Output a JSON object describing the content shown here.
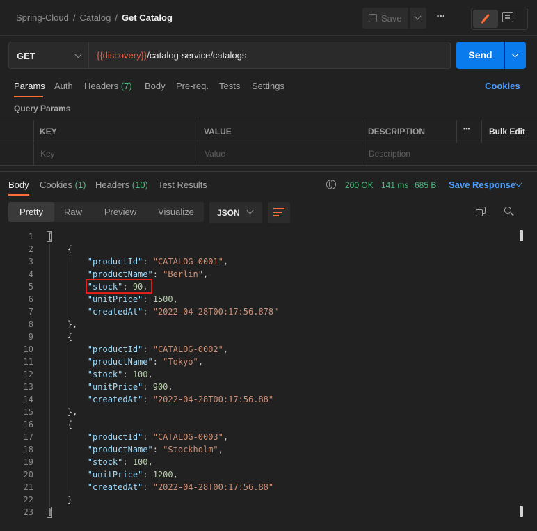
{
  "breadcrumb": {
    "items": [
      "Spring-Cloud",
      "Catalog"
    ],
    "separator": "/",
    "current": "Get Catalog"
  },
  "header": {
    "save_label": "Save",
    "more_label": "•••"
  },
  "request": {
    "method": "GET",
    "url_variable": "{{discovery}}",
    "url_path": "/catalog-service/catalogs",
    "send_label": "Send"
  },
  "request_tabs": {
    "params": "Params",
    "auth": "Auth",
    "headers": "Headers",
    "headers_count": "(7)",
    "body": "Body",
    "prereq": "Pre-req.",
    "tests": "Tests",
    "settings": "Settings",
    "cookies": "Cookies"
  },
  "query_params": {
    "title": "Query Params",
    "columns": [
      "KEY",
      "VALUE",
      "DESCRIPTION"
    ],
    "bulk_edit": "Bulk Edit",
    "more": "•••",
    "placeholders": {
      "key": "Key",
      "value": "Value",
      "description": "Description"
    }
  },
  "response_tabs": {
    "body": "Body",
    "cookies": "Cookies",
    "cookies_count": "(1)",
    "headers": "Headers",
    "headers_count": "(10)",
    "test_results": "Test Results"
  },
  "response_status": {
    "status": "200 OK",
    "time": "141 ms",
    "size": "685 B",
    "save_response": "Save Response"
  },
  "view_tabs": {
    "pretty": "Pretty",
    "raw": "Raw",
    "preview": "Preview",
    "visualize": "Visualize",
    "format": "JSON"
  },
  "code": {
    "line_numbers": [
      "1",
      "2",
      "3",
      "4",
      "5",
      "6",
      "7",
      "8",
      "9",
      "10",
      "11",
      "12",
      "13",
      "14",
      "15",
      "16",
      "17",
      "18",
      "19",
      "20",
      "21",
      "22",
      "23"
    ],
    "catalog": [
      {
        "productId": "\"CATALOG-0001\"",
        "productName": "\"Berlin\"",
        "stock": "90",
        "unitPrice": "1500",
        "createdAt": "\"2022-04-28T00:17:56.878\""
      },
      {
        "productId": "\"CATALOG-0002\"",
        "productName": "\"Tokyo\"",
        "stock": "100",
        "unitPrice": "900",
        "createdAt": "\"2022-04-28T00:17:56.88\""
      },
      {
        "productId": "\"CATALOG-0003\"",
        "productName": "\"Stockholm\"",
        "stock": "100",
        "unitPrice": "1200",
        "createdAt": "\"2022-04-28T00:17:56.88\""
      }
    ],
    "keys": {
      "productId": "\"productId\"",
      "productName": "\"productName\"",
      "stock": "\"stock\"",
      "unitPrice": "\"unitPrice\"",
      "createdAt": "\"createdAt\""
    }
  },
  "colors": {
    "accent": "#ff6c37",
    "send": "#097bed",
    "link": "#4c9fff",
    "status_ok": "#49b97c",
    "highlight_box": "#e0201b"
  },
  "icons": [
    "save-icon",
    "chevron-down-icon",
    "more-icon",
    "edit-icon",
    "documentation-icon",
    "globe-icon",
    "wrap-lines-icon",
    "copy-icon",
    "search-icon"
  ]
}
